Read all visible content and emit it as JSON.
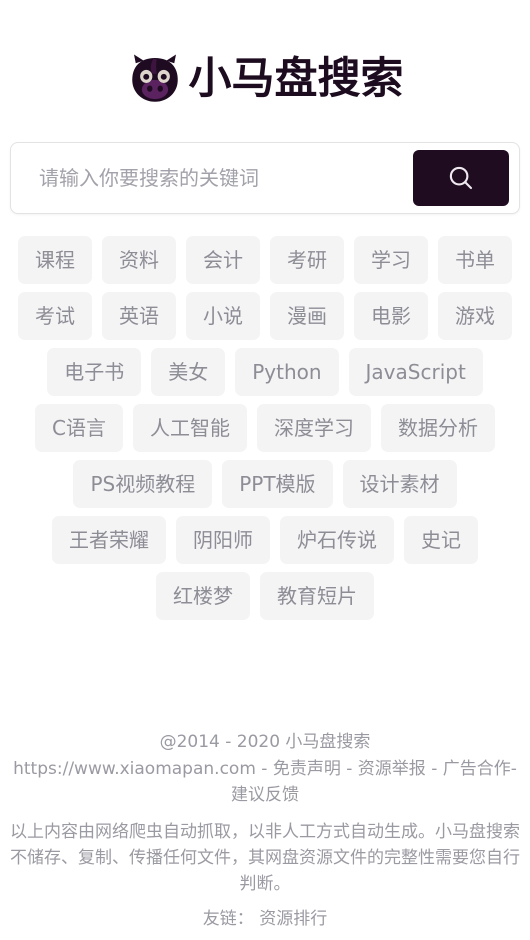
{
  "site": {
    "title": "小马盘搜索",
    "logo_icon": "pony-head-icon",
    "title_color": "#1d0b1f"
  },
  "search": {
    "placeholder": "请输入你要搜索的关键词",
    "value": "",
    "button_icon": "search-icon",
    "button_color": "#1f0c21"
  },
  "tags": {
    "background_color": "#f4f4f5",
    "text_color": "#8d8d96",
    "rows": [
      [
        "课程",
        "资料",
        "会计",
        "考研",
        "学习",
        "书单"
      ],
      [
        "考试",
        "英语",
        "小说",
        "漫画",
        "电影",
        "游戏"
      ],
      [
        "电子书",
        "美女",
        "Python",
        "JavaScript"
      ],
      [
        "C语言",
        "人工智能",
        "深度学习",
        "数据分析"
      ],
      [
        "PS视频教程",
        "PPT模版",
        "设计素材"
      ],
      [
        "王者荣耀",
        "阴阳师",
        "炉石传说",
        "史记"
      ],
      [
        "红楼梦",
        "教育短片"
      ]
    ]
  },
  "footer": {
    "copyright": "@2014 - 2020 小马盘搜索",
    "url": "https://www.xiaomapan.com",
    "sep": "-",
    "links": [
      "免责声明",
      "资源举报",
      "广告合作-",
      "建议反馈"
    ],
    "disclaimer": "以上内容由网络爬虫自动抓取，以非人工方式自动生成。小马盘搜索不储存、复制、传播任何文件，其网盘资源文件的完整性需要您自行判断。",
    "friend_label": "友链：",
    "friend_link": "资源排行",
    "text_color": "#9a9aa2"
  }
}
